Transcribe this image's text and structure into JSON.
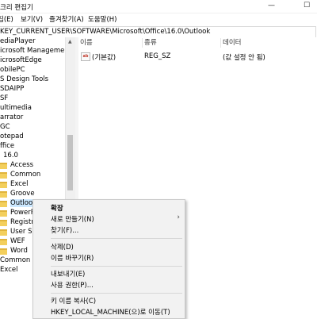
{
  "window": {
    "title": "크리 편집기",
    "minimize_glyph": "—",
    "maximize_glyph": "☐"
  },
  "menubar": {
    "items": [
      "집(E)",
      "보기(V)",
      "즐겨찾기(A)",
      "도움말(H)"
    ]
  },
  "address": {
    "path": "KEY_CURRENT_USER\\SOFTWARE\\Microsoft\\Office\\16.0\\Outlook"
  },
  "tree": {
    "items": [
      {
        "label": "ediaPlayer"
      },
      {
        "label": "icrosoft Management Co"
      },
      {
        "label": "icrosoftEdge"
      },
      {
        "label": "obilePC"
      },
      {
        "label": "S Design Tools"
      },
      {
        "label": "SDAIPP"
      },
      {
        "label": "SF"
      },
      {
        "label": "ultimedia"
      },
      {
        "label": "arrator"
      },
      {
        "label": "GC"
      },
      {
        "label": "otepad"
      },
      {
        "label": "ffice"
      },
      {
        "label": "16.0"
      },
      {
        "label": "Access"
      },
      {
        "label": "Common"
      },
      {
        "label": "Excel"
      },
      {
        "label": "Groove"
      },
      {
        "label": "Outlook"
      },
      {
        "label": "PowerP"
      },
      {
        "label": "Registra"
      },
      {
        "label": "User Set"
      },
      {
        "label": "WEF"
      },
      {
        "label": "Word"
      },
      {
        "label": "Common"
      },
      {
        "label": "Excel"
      }
    ]
  },
  "list": {
    "columns": [
      "이름",
      "종류",
      "데이터"
    ],
    "rows": [
      {
        "name": "(기본값)",
        "type": "REG_SZ",
        "data": "(값 설정 안 됨)",
        "icon": "ab-string-icon"
      }
    ]
  },
  "context_menu": {
    "items": [
      {
        "label": "확장",
        "bold": true
      },
      {
        "label": "새로 만들기(N)",
        "submenu": true
      },
      {
        "label": "찾기(F)..."
      },
      {
        "label": "삭제(D)"
      },
      {
        "label": "이름 바꾸기(R)"
      },
      {
        "label": "내보내기(E)"
      },
      {
        "label": "사용 권한(P)..."
      },
      {
        "label": "키 이름 복사(C)"
      },
      {
        "label": "HKEY_LOCAL_MACHINE(으)로 이동(T)"
      }
    ],
    "submenu_arrow": "›"
  },
  "colors": {
    "selection": "#cce8ff",
    "folder": "#f3cf5c",
    "menu_background": "#f2f2f2"
  }
}
